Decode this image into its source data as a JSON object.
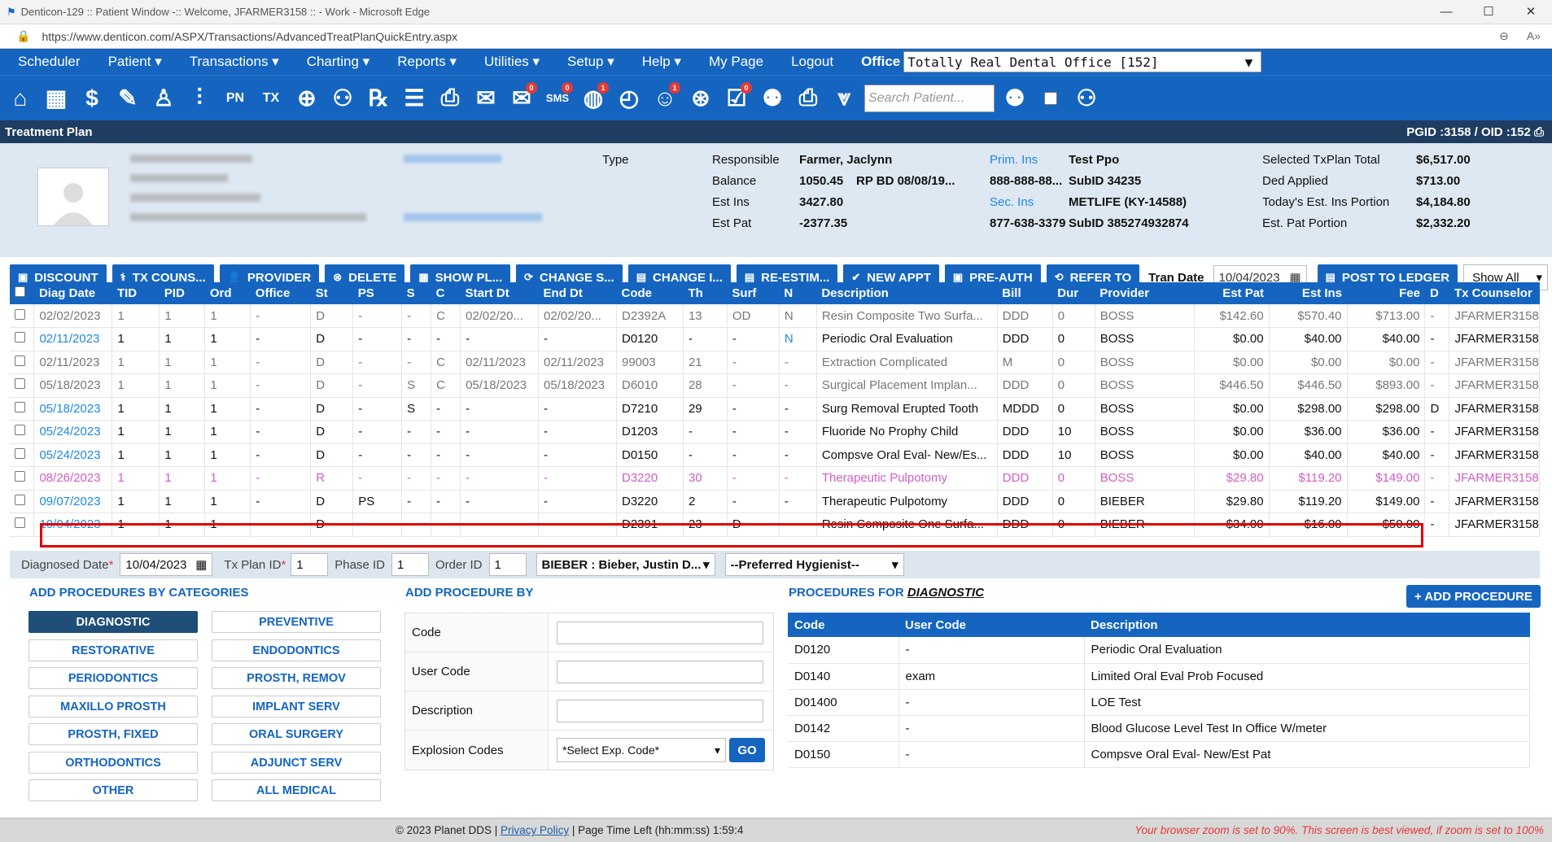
{
  "window": {
    "title": "Denticon-129 :: Patient Window -:: Welcome, JFARMER3158 :: - Work - Microsoft Edge",
    "url": "https://www.denticon.com/ASPX/Transactions/AdvancedTreatPlanQuickEntry.aspx",
    "min": "—",
    "max": "☐",
    "close": "✕",
    "zoom": "⊖",
    "read": "A»"
  },
  "menu": {
    "items": [
      "Scheduler",
      "Patient ▾",
      "Transactions ▾",
      "Charting ▾",
      "Reports ▾",
      "Utilities ▾",
      "Setup ▾",
      "Help ▾",
      "My Page",
      "Logout"
    ],
    "office_label": "Office",
    "office_value": "Totally Real Dental Office [152]"
  },
  "iconbar": {
    "search_placeholder": "Search Patient...",
    "icons": [
      "home-icon",
      "calendar-icon",
      "billing-icon",
      "notes-icon",
      "tooth-icon",
      "implant-icon",
      "pn-icon",
      "tx-icon",
      "add-patient-icon",
      "family-icon",
      "rx-icon",
      "forms-icon",
      "print-doc-icon",
      "mail-icon",
      "message-icon",
      "sms-icon",
      "globe-icon",
      "clock-icon",
      "recall-icon",
      "web-icon",
      "tasks-icon",
      "users-icon",
      "printer-icon",
      "collapse-icon"
    ],
    "labels": {
      "pn": "PN",
      "tx": "TX",
      "rx": "℞",
      "sms": "SMS"
    },
    "badges": {
      "message": "0",
      "sms": "0",
      "globe": "1",
      "recall": "1",
      "tasks": "0"
    }
  },
  "header": {
    "title": "Treatment Plan",
    "pgid": "PGID :3158  /  OID :152"
  },
  "patient": {
    "type_label": "Type",
    "responsible_label": "Responsible",
    "responsible": "Farmer, Jaclynn",
    "balance_label": "Balance",
    "balance": "1050.45",
    "rpbd": "RP BD  08/08/19...",
    "estins_label": "Est Ins",
    "estins": "3427.80",
    "estpat_label": "Est Pat",
    "estpat": "-2377.35",
    "prim_label": "Prim. Ins",
    "prim": "Test Ppo",
    "prim_phone": "888-888-88...",
    "prim_sub": "SubID 34235",
    "sec_label": "Sec. Ins",
    "sec": "METLIFE (KY-14588)",
    "sec_phone": "877-638-3379",
    "sec_sub": "SubID 385274932874",
    "sel_total_label": "Selected TxPlan Total",
    "sel_total": "$6,517.00",
    "ded_label": "Ded Applied",
    "ded": "$713.00",
    "today_ins_label": "Today's Est. Ins Portion",
    "today_ins": "$4,184.80",
    "est_pat_label": "Est. Pat Portion",
    "est_pat": "$2,332.20"
  },
  "actions": {
    "buttons": [
      "DISCOUNT",
      "TX COUNS...",
      "PROVIDER",
      "DELETE",
      "SHOW PL...",
      "CHANGE S...",
      "CHANGE I...",
      "RE-ESTIM...",
      "NEW APPT",
      "PRE-AUTH",
      "REFER TO"
    ],
    "icons": [
      "▣",
      "⚕",
      "👤",
      "⊗",
      "▦",
      "⟳",
      "▤",
      "▤",
      "✔",
      "▣",
      "⟲"
    ],
    "tran_label": "Tran Date",
    "tran_date": "10/04/2023",
    "post": "POST TO LEDGER",
    "post_icon": "▤",
    "show": "Show All",
    "cal_icon": "▦",
    "dropdown_icon": "▾"
  },
  "grid": {
    "columns": [
      "Diag Date",
      "TID",
      "PID",
      "Ord",
      "Office",
      "St",
      "PS",
      "S",
      "C",
      "Start Dt",
      "End Dt",
      "Code",
      "Th",
      "Surf",
      "N",
      "Description",
      "Bill",
      "Dur",
      "Provider",
      "Est Pat",
      "Est Ins",
      "Fee",
      "D",
      "Tx Counselor"
    ],
    "rows": [
      [
        "02/02/2023",
        "1",
        "1",
        "1",
        "-",
        "D",
        "-",
        "-",
        "C",
        "02/02/20...",
        "02/02/20...",
        "D2392A",
        "13",
        "OD",
        "N",
        "Resin Composite Two Surfa...",
        "DDD",
        "0",
        "BOSS",
        "$142.60",
        "$570.40",
        "$713.00",
        "-",
        "JFARMER3158"
      ],
      [
        "02/11/2023",
        "1",
        "1",
        "1",
        "-",
        "D",
        "-",
        "-",
        "-",
        "-",
        "-",
        "D0120",
        "-",
        "-",
        "N",
        "Periodic Oral Evaluation",
        "DDD",
        "0",
        "BOSS",
        "$0.00",
        "$40.00",
        "$40.00",
        "-",
        "JFARMER3158"
      ],
      [
        "02/11/2023",
        "1",
        "1",
        "1",
        "-",
        "D",
        "-",
        "-",
        "C",
        "02/11/2023",
        "02/11/2023",
        "99003",
        "21",
        "-",
        "-",
        "Extraction Complicated",
        "M",
        "0",
        "BOSS",
        "$0.00",
        "$0.00",
        "$0.00",
        "-",
        "JFARMER3158"
      ],
      [
        "05/18/2023",
        "1",
        "1",
        "1",
        "-",
        "D",
        "-",
        "S",
        "C",
        "05/18/2023",
        "05/18/2023",
        "D6010",
        "28",
        "-",
        "-",
        "Surgical Placement Implan...",
        "DDD",
        "0",
        "BOSS",
        "$446.50",
        "$446.50",
        "$893.00",
        "-",
        "JFARMER3158"
      ],
      [
        "05/18/2023",
        "1",
        "1",
        "1",
        "-",
        "D",
        "-",
        "S",
        "-",
        "-",
        "-",
        "D7210",
        "29",
        "-",
        "-",
        "Surg Removal Erupted Tooth",
        "MDDD",
        "0",
        "BOSS",
        "$0.00",
        "$298.00",
        "$298.00",
        "D",
        "JFARMER3158"
      ],
      [
        "05/24/2023",
        "1",
        "1",
        "1",
        "-",
        "D",
        "-",
        "-",
        "-",
        "-",
        "-",
        "D1203",
        "-",
        "-",
        "-",
        "Fluoride No Prophy Child",
        "DDD",
        "10",
        "BOSS",
        "$0.00",
        "$36.00",
        "$36.00",
        "-",
        "JFARMER3158"
      ],
      [
        "05/24/2023",
        "1",
        "1",
        "1",
        "-",
        "D",
        "-",
        "-",
        "-",
        "-",
        "-",
        "D0150",
        "-",
        "-",
        "-",
        "Compsve Oral Eval- New/Es...",
        "DDD",
        "10",
        "BOSS",
        "$0.00",
        "$40.00",
        "$40.00",
        "-",
        "JFARMER3158"
      ],
      [
        "08/26/2023",
        "1",
        "1",
        "1",
        "-",
        "R",
        "-",
        "-",
        "-",
        "-",
        "-",
        "D3220",
        "30",
        "-",
        "-",
        "Therapeutic Pulpotomy",
        "DDD",
        "0",
        "BOSS",
        "$29.80",
        "$119.20",
        "$149.00",
        "-",
        "JFARMER3158"
      ],
      [
        "09/07/2023",
        "1",
        "1",
        "1",
        "-",
        "D",
        "PS",
        "-",
        "-",
        "-",
        "-",
        "D3220",
        "2",
        "-",
        "-",
        "Therapeutic Pulpotomy",
        "DDD",
        "0",
        "BIEBER",
        "$29.80",
        "$119.20",
        "$149.00",
        "-",
        "JFARMER3158"
      ],
      [
        "10/04/2023",
        "1",
        "1",
        "1",
        "-",
        "D",
        "-",
        "-",
        "-",
        "-",
        "-",
        "D2391",
        "23",
        "D",
        "-",
        "Resin Composite One Surfa...",
        "DDD",
        "0",
        "BIEBER",
        "$34.00",
        "$16.00",
        "$50.00",
        "-",
        "JFARMER3158"
      ]
    ]
  },
  "entry": {
    "diag_label": "Diagnosed Date",
    "diag": "10/04/2023",
    "txplan_label": "Tx Plan ID",
    "txplan": "1",
    "phase_label": "Phase ID",
    "phase": "1",
    "order_label": "Order ID",
    "order": "1",
    "provider": "BIEBER : Bieber, Justin D...",
    "hygienist": "--Preferred Hygienist--",
    "req": "*"
  },
  "categories": {
    "title": "ADD PROCEDURES BY CATEGORIES",
    "left": [
      "DIAGNOSTIC",
      "RESTORATIVE",
      "PERIODONTICS",
      "MAXILLO PROSTH",
      "PROSTH, FIXED",
      "ORTHODONTICS",
      "OTHER"
    ],
    "right": [
      "PREVENTIVE",
      "ENDODONTICS",
      "PROSTH, REMOV",
      "IMPLANT SERV",
      "ORAL SURGERY",
      "ADJUNCT SERV",
      "ALL MEDICAL"
    ]
  },
  "addby": {
    "title": "ADD PROCEDURE BY",
    "code": "Code",
    "user_code": "User Code",
    "description": "Description",
    "explosion": "Explosion Codes",
    "select": "*Select Exp. Code*",
    "go": "GO"
  },
  "procs": {
    "title_prefix": "PROCEDURES FOR",
    "title_cat": "DIAGNOSTIC",
    "add": "+ ADD PROCEDURE",
    "columns": [
      "Code",
      "User Code",
      "Description"
    ],
    "rows": [
      [
        "D0120",
        "-",
        "Periodic Oral Evaluation"
      ],
      [
        "D0140",
        "exam",
        "Limited Oral Eval Prob Focused"
      ],
      [
        "D01400",
        "-",
        "LOE Test"
      ],
      [
        "D0142",
        "-",
        "Blood Glucose Level Test In Office W/meter"
      ],
      [
        "D0150",
        "-",
        "Compsve Oral Eval- New/Est Pat"
      ]
    ]
  },
  "footer": {
    "copy": "© 2023 Planet DDS |",
    "privacy": "Privacy Policy",
    "time": "| Page Time Left (hh:mm:ss) 1:59:4",
    "warn": "Your browser zoom is set to 90%. This screen is best viewed, if zoom is set to 100%"
  }
}
